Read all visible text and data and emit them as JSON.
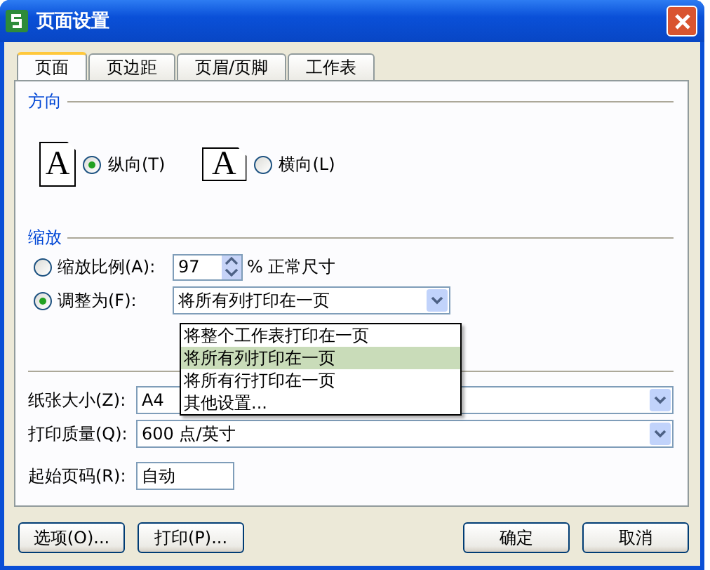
{
  "window": {
    "title": "页面设置"
  },
  "tabs": [
    {
      "label": "页面",
      "selected": true
    },
    {
      "label": "页边距",
      "selected": false
    },
    {
      "label": "页眉/页脚",
      "selected": false
    },
    {
      "label": "工作表",
      "selected": false
    }
  ],
  "orientation": {
    "label": "方向",
    "options": [
      {
        "kind": "portrait",
        "icon_text": "A",
        "label": "纵向(T)",
        "selected": true
      },
      {
        "kind": "landscape",
        "icon_text": "A",
        "label": "横向(L)",
        "selected": false
      }
    ]
  },
  "scaling": {
    "label": "缩放",
    "options": [
      {
        "kind": "percent",
        "label": "缩放比例(A):",
        "selected": false,
        "value": "97",
        "suffix": "% 正常尺寸"
      },
      {
        "kind": "fit",
        "label": "调整为(F):",
        "selected": true,
        "value": "将所有列打印在一页"
      }
    ],
    "dropdown": [
      {
        "label": "将整个工作表打印在一页",
        "selected": false
      },
      {
        "label": "将所有列打印在一页",
        "selected": true
      },
      {
        "label": "将所有行打印在一页",
        "selected": false
      },
      {
        "label": "其他设置...",
        "selected": false
      }
    ]
  },
  "paper_size": {
    "label": "纸张大小(Z):",
    "value": "A4"
  },
  "print_quality": {
    "label": "打印质量(Q):",
    "value": "600 点/英寸"
  },
  "first_page": {
    "label": "起始页码(R):",
    "value": "自动"
  },
  "buttons": [
    {
      "label": "选项(O)...",
      "kind": "left"
    },
    {
      "label": "打印(P)...",
      "kind": "left"
    },
    {
      "label": "确定",
      "kind": "right"
    },
    {
      "label": "取消",
      "kind": "right"
    }
  ]
}
